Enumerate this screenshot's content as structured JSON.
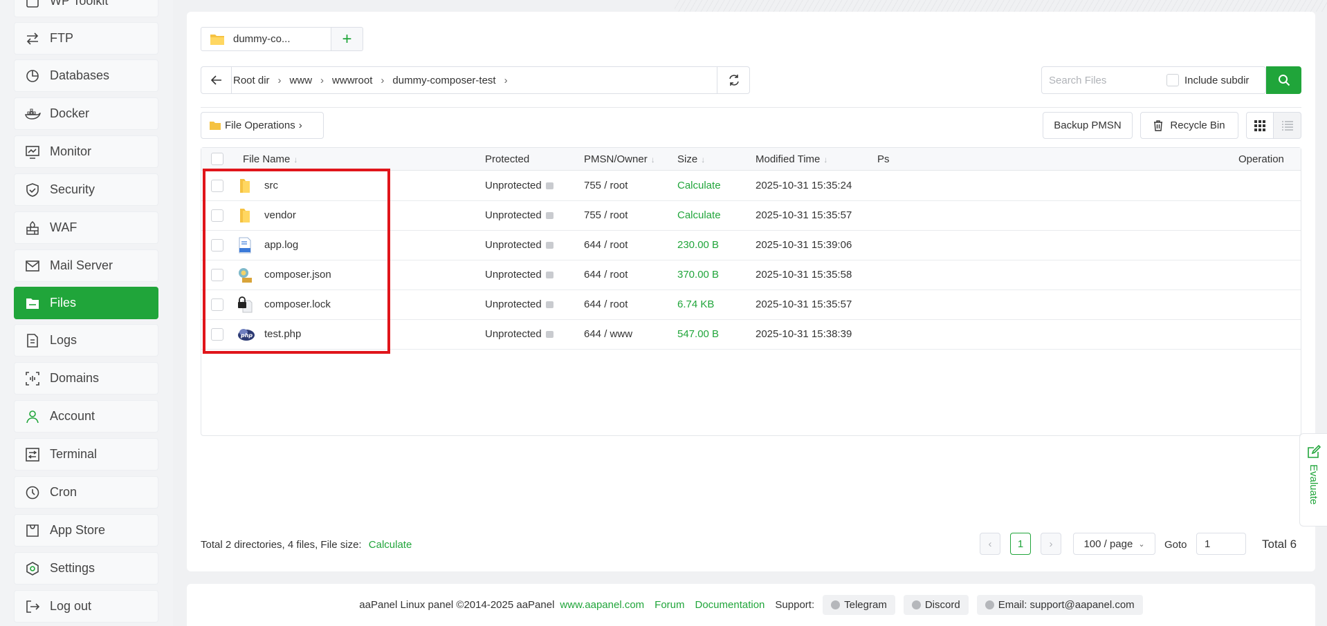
{
  "sidebar": {
    "items": [
      {
        "label": "WP Toolkit",
        "icon": "wordpress-icon",
        "active": false
      },
      {
        "label": "FTP",
        "icon": "ftp-icon",
        "active": false
      },
      {
        "label": "Databases",
        "icon": "database-icon",
        "active": false
      },
      {
        "label": "Docker",
        "icon": "docker-icon",
        "active": false
      },
      {
        "label": "Monitor",
        "icon": "monitor-icon",
        "active": false
      },
      {
        "label": "Security",
        "icon": "shield-icon",
        "active": false
      },
      {
        "label": "WAF",
        "icon": "firewall-icon",
        "active": false
      },
      {
        "label": "Mail Server",
        "icon": "mail-icon",
        "active": false
      },
      {
        "label": "Files",
        "icon": "folder-icon",
        "active": true
      },
      {
        "label": "Logs",
        "icon": "logs-icon",
        "active": false
      },
      {
        "label": "Domains",
        "icon": "domains-icon",
        "active": false
      },
      {
        "label": "Account",
        "icon": "user-icon",
        "active": false
      },
      {
        "label": "Terminal",
        "icon": "terminal-icon",
        "active": false
      },
      {
        "label": "Cron",
        "icon": "clock-icon",
        "active": false
      },
      {
        "label": "App Store",
        "icon": "store-icon",
        "active": false
      },
      {
        "label": "Settings",
        "icon": "settings-icon",
        "active": false
      },
      {
        "label": "Log out",
        "icon": "logout-icon",
        "active": false
      }
    ]
  },
  "tabs": [
    {
      "label": "dummy-co..."
    }
  ],
  "path": {
    "crumbs": [
      "Root dir",
      "www",
      "wwwroot",
      "dummy-composer-test"
    ]
  },
  "search": {
    "placeholder": "Search Files",
    "include_subdir_label": "Include subdir"
  },
  "toolbar": {
    "file_operations": "File Operations",
    "backup_pmsn": "Backup PMSN",
    "recycle_bin": "Recycle Bin"
  },
  "table": {
    "columns": {
      "name": "File Name",
      "protected": "Protected",
      "pmsn": "PMSN/Owner",
      "size": "Size",
      "modified": "Modified Time",
      "ps": "Ps",
      "operation": "Operation"
    },
    "rows": [
      {
        "name": "src",
        "type": "folder",
        "protected": "Unprotected",
        "pmsn": "755 / root",
        "size": "Calculate",
        "modified": "2025-10-31 15:35:24"
      },
      {
        "name": "vendor",
        "type": "folder",
        "protected": "Unprotected",
        "pmsn": "755 / root",
        "size": "Calculate",
        "modified": "2025-10-31 15:35:57"
      },
      {
        "name": "app.log",
        "type": "log",
        "protected": "Unprotected",
        "pmsn": "644 / root",
        "size": "230.00 B",
        "modified": "2025-10-31 15:39:06"
      },
      {
        "name": "composer.json",
        "type": "json",
        "protected": "Unprotected",
        "pmsn": "644 / root",
        "size": "370.00 B",
        "modified": "2025-10-31 15:35:58"
      },
      {
        "name": "composer.lock",
        "type": "lock",
        "protected": "Unprotected",
        "pmsn": "644 / root",
        "size": "6.74 KB",
        "modified": "2025-10-31 15:35:57"
      },
      {
        "name": "test.php",
        "type": "php",
        "protected": "Unprotected",
        "pmsn": "644 / www",
        "size": "547.00 B",
        "modified": "2025-10-31 15:38:39"
      }
    ]
  },
  "summary": {
    "text": "Total 2 directories, 4 files, File size:",
    "calculate": "Calculate"
  },
  "pagination": {
    "current_page": "1",
    "page_size": "100 / page",
    "goto_label": "Goto",
    "goto_value": "1",
    "total": "Total 6"
  },
  "evaluate": {
    "label": "Evaluate"
  },
  "footer": {
    "copyright": "aaPanel Linux panel ©2014-2025 aaPanel",
    "site_link": "www.aapanel.com",
    "forum": "Forum",
    "documentation": "Documentation",
    "support_label": "Support:",
    "telegram": "Telegram",
    "discord": "Discord",
    "email": "Email: support@aapanel.com"
  },
  "colors": {
    "accent": "#20a53a",
    "highlight": "#e0151b"
  }
}
